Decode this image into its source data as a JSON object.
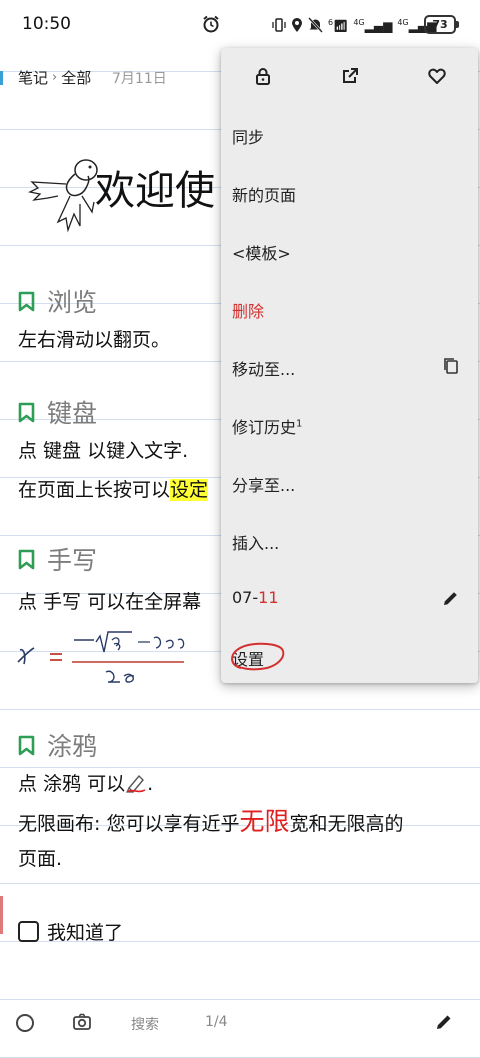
{
  "status_bar": {
    "time": "10:50",
    "icons": [
      "alarm-icon",
      "vibrate-icon",
      "location-icon",
      "mute-icon",
      "wifi-icon",
      "signal-icon",
      "signal-icon"
    ],
    "wifi_label": "6",
    "signal1_label": "4G",
    "signal2_label": "4G",
    "battery": "73"
  },
  "note_header": {
    "crumb_notebook": "笔记",
    "crumb_separator": "›",
    "crumb_folder": "全部",
    "date": "7月11日"
  },
  "page": {
    "welcome_title": "欢迎使",
    "sections": [
      {
        "title": "浏览",
        "lines": [
          "左右滑动以翻页。"
        ]
      },
      {
        "title": "键盘",
        "lines": [
          "点 键盘 以键入文字.",
          "在页面上长按可以",
          "设定"
        ]
      },
      {
        "title": "手写",
        "lines": [
          "点 手写 可以在全屏幕"
        ]
      },
      {
        "title": "涂鸦",
        "lines": [
          "点 涂鸦 可以",
          ".",
          "无限画布: 您可以享有近乎",
          "无限",
          "宽和无限高的",
          "页面."
        ]
      }
    ],
    "checkbox_label": "我知道了"
  },
  "bottom_bar": {
    "search_label": "搜索",
    "page_indicator": "1/4"
  },
  "menu": {
    "top_icons": [
      "lock-icon",
      "open-external-icon",
      "heart-icon"
    ],
    "items": [
      {
        "label": "同步"
      },
      {
        "label": "新的页面"
      },
      {
        "label": "<模板>"
      },
      {
        "label": "删除",
        "color": "#d32f2f"
      },
      {
        "label": "移动至...",
        "icon": "copy-icon"
      },
      {
        "label": "修订历史",
        "superscript": "1"
      },
      {
        "label": "分享至..."
      },
      {
        "label": "插入..."
      },
      {
        "label_prefix": "07-",
        "label_suffix": "11",
        "icon": "pencil-icon"
      },
      {
        "label": "设置"
      }
    ]
  },
  "colors": {
    "accent_blue": "#3aa0d8",
    "bookmark_green": "#2e9d55",
    "delete_red": "#d32f2f",
    "highlight_yellow": "#ffff33",
    "line_blue": "#d3def0",
    "menu_background": "#ececec"
  }
}
